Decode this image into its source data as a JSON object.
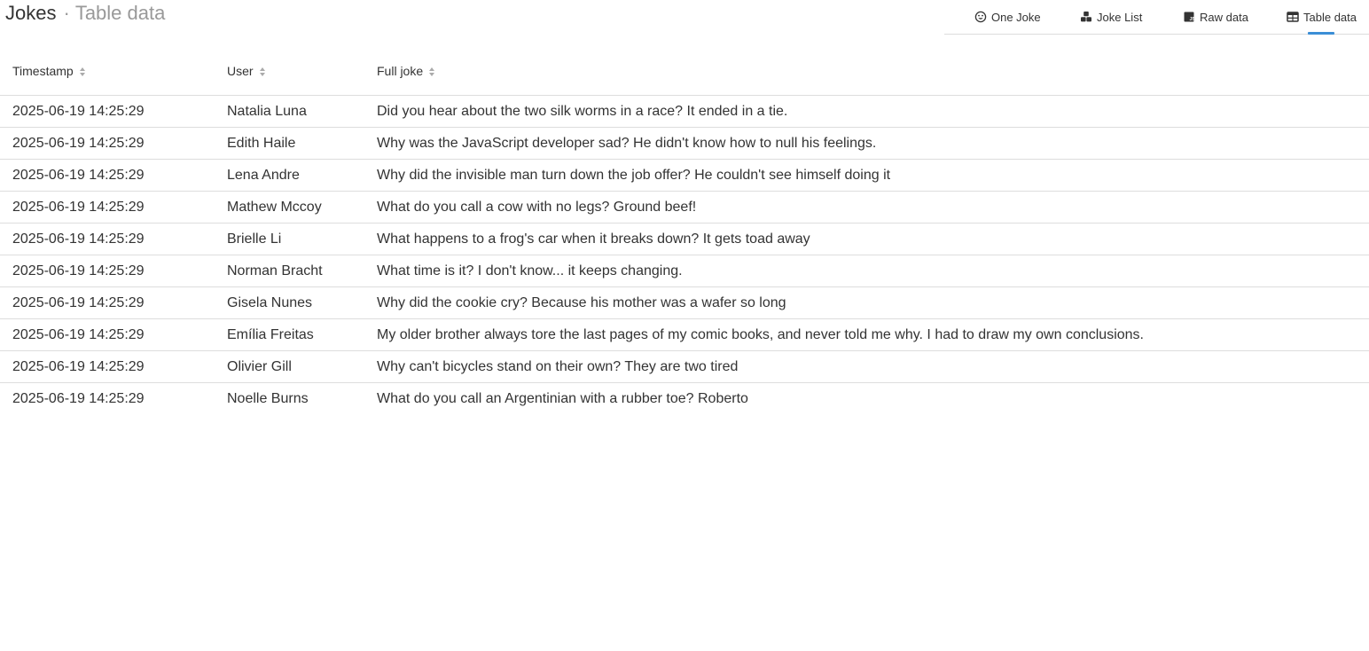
{
  "header": {
    "app_title": "Jokes",
    "separator": "·",
    "view_title": "Table data"
  },
  "tabs": [
    {
      "label": "One Joke",
      "icon": "smiley-face-icon"
    },
    {
      "label": "Joke List",
      "icon": "cubes-icon"
    },
    {
      "label": "Raw data",
      "icon": "js-file-icon"
    },
    {
      "label": "Table data",
      "icon": "table-icon",
      "active": true
    }
  ],
  "accent_color": "#3b8ed6",
  "table": {
    "columns": [
      "Timestamp",
      "User",
      "Full joke"
    ],
    "rows": [
      {
        "timestamp": "2025-06-19 14:25:29",
        "user": "Natalia Luna",
        "joke": "Did you hear about the two silk worms in a race? It ended in a tie."
      },
      {
        "timestamp": "2025-06-19 14:25:29",
        "user": "Edith Haile",
        "joke": "Why was the JavaScript developer sad? He didn't know how to null his feelings."
      },
      {
        "timestamp": "2025-06-19 14:25:29",
        "user": "Lena Andre",
        "joke": "Why did the invisible man turn down the job offer? He couldn't see himself doing it"
      },
      {
        "timestamp": "2025-06-19 14:25:29",
        "user": "Mathew Mccoy",
        "joke": "What do you call a cow with no legs? Ground beef!"
      },
      {
        "timestamp": "2025-06-19 14:25:29",
        "user": "Brielle Li",
        "joke": "What happens to a frog's car when it breaks down? It gets toad away"
      },
      {
        "timestamp": "2025-06-19 14:25:29",
        "user": "Norman Bracht",
        "joke": "What time is it? I don't know... it keeps changing."
      },
      {
        "timestamp": "2025-06-19 14:25:29",
        "user": "Gisela Nunes",
        "joke": "Why did the cookie cry? Because his mother was a wafer so long"
      },
      {
        "timestamp": "2025-06-19 14:25:29",
        "user": "Emília Freitas",
        "joke": "My older brother always tore the last pages of my comic books, and never told me why. I had to draw my own conclusions."
      },
      {
        "timestamp": "2025-06-19 14:25:29",
        "user": "Olivier Gill",
        "joke": "Why can't bicycles stand on their own? They are two tired"
      },
      {
        "timestamp": "2025-06-19 14:25:29",
        "user": "Noelle Burns",
        "joke": "What do you call an Argentinian with a rubber toe? Roberto"
      }
    ]
  }
}
